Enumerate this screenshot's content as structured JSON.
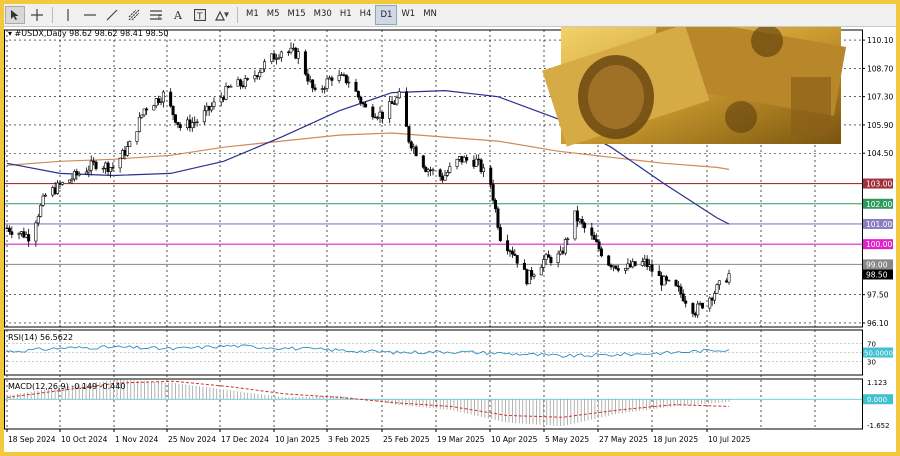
{
  "toolbar": {
    "timeframes": [
      "M1",
      "M5",
      "M15",
      "M30",
      "H1",
      "H4",
      "D1",
      "W1",
      "MN"
    ],
    "active_timeframe": "D1",
    "tools": [
      "cursor-icon",
      "crosshair-icon",
      "vertical-line-icon",
      "horizontal-line-icon",
      "trendline-icon",
      "channel-icon",
      "fibonacci-icon",
      "text-icon",
      "label-icon",
      "shapes-icon"
    ]
  },
  "header": {
    "symbol_label": "#USDX,Daily",
    "ohlc": "98.62 98.62 98.41 98.50"
  },
  "colors": {
    "candle": "#000000",
    "ma_fast": "#2b2f8f",
    "ma_slow": "#d08a55",
    "level_103": "#a0323c",
    "level_102": "#2e9a5e",
    "level_101": "#8a7ec0",
    "level_100": "#e020c8",
    "level_99": "#888888",
    "rsi": "#2f8fc0",
    "macd_signal": "#d03030",
    "macd_hist": "#a0a0a0",
    "macd_zero": "#40c0d0"
  },
  "chart_data": [
    {
      "type": "candlestick",
      "title": "#USDX,Daily",
      "ylim": [
        95.9,
        110.6
      ],
      "y_ticks": [
        110.1,
        108.7,
        107.3,
        105.9,
        104.5,
        97.5,
        96.1
      ],
      "x_ticks": [
        "18 Sep 2024",
        "10 Oct 2024",
        "1 Nov 2024",
        "25 Nov 2024",
        "17 Dec 2024",
        "10 Jan 2025",
        "3 Feb 2025",
        "25 Feb 2025",
        "19 Mar 2025",
        "10 Apr 2025",
        "5 May 2025",
        "27 May 2025",
        "18 Jun 2025",
        "10 Jul 2025"
      ],
      "close_path": [
        [
          "2024-09-18",
          100.8
        ],
        [
          "2024-09-27",
          100.4
        ],
        [
          "2024-10-04",
          102.4
        ],
        [
          "2024-10-10",
          102.9
        ],
        [
          "2024-10-18",
          103.5
        ],
        [
          "2024-10-25",
          104.0
        ],
        [
          "2024-11-01",
          103.8
        ],
        [
          "2024-11-08",
          104.9
        ],
        [
          "2024-11-14",
          106.7
        ],
        [
          "2024-11-22",
          107.4
        ],
        [
          "2024-11-29",
          105.8
        ],
        [
          "2024-12-06",
          106.1
        ],
        [
          "2024-12-13",
          106.9
        ],
        [
          "2024-12-20",
          107.8
        ],
        [
          "2024-12-27",
          108.0
        ],
        [
          "2025-01-03",
          108.9
        ],
        [
          "2025-01-10",
          109.6
        ],
        [
          "2025-01-17",
          109.4
        ],
        [
          "2025-01-24",
          107.4
        ],
        [
          "2025-01-31",
          108.3
        ],
        [
          "2025-02-07",
          108.1
        ],
        [
          "2025-02-14",
          106.7
        ],
        [
          "2025-02-21",
          106.4
        ],
        [
          "2025-02-28",
          107.3
        ],
        [
          "2025-03-04",
          105.2
        ],
        [
          "2025-03-11",
          103.8
        ],
        [
          "2025-03-18",
          103.3
        ],
        [
          "2025-03-25",
          104.2
        ],
        [
          "2025-04-01",
          104.1
        ],
        [
          "2025-04-07",
          103.0
        ],
        [
          "2025-04-11",
          100.4
        ],
        [
          "2025-04-17",
          99.5
        ],
        [
          "2025-04-22",
          98.3
        ],
        [
          "2025-04-29",
          99.2
        ],
        [
          "2025-05-06",
          99.4
        ],
        [
          "2025-05-12",
          101.4
        ],
        [
          "2025-05-19",
          100.3
        ],
        [
          "2025-05-26",
          99.1
        ],
        [
          "2025-06-02",
          98.8
        ],
        [
          "2025-06-10",
          99.1
        ],
        [
          "2025-06-17",
          98.2
        ],
        [
          "2025-06-24",
          97.7
        ],
        [
          "2025-07-01",
          96.7
        ],
        [
          "2025-07-08",
          97.5
        ],
        [
          "2025-07-15",
          98.5
        ]
      ],
      "ma_fast": [
        [
          "2024-09-18",
          104.0
        ],
        [
          "2024-10-10",
          103.5
        ],
        [
          "2024-11-01",
          103.4
        ],
        [
          "2024-11-25",
          103.5
        ],
        [
          "2024-12-17",
          104.1
        ],
        [
          "2025-01-10",
          105.3
        ],
        [
          "2025-02-03",
          106.6
        ],
        [
          "2025-02-25",
          107.5
        ],
        [
          "2025-03-19",
          107.6
        ],
        [
          "2025-04-10",
          107.3
        ],
        [
          "2025-05-05",
          106.2
        ],
        [
          "2025-05-27",
          104.8
        ],
        [
          "2025-06-18",
          103.0
        ],
        [
          "2025-07-10",
          101.3
        ],
        [
          "2025-07-15",
          101.0
        ]
      ],
      "ma_slow": [
        [
          "2024-09-18",
          103.9
        ],
        [
          "2024-10-10",
          104.1
        ],
        [
          "2024-11-01",
          104.2
        ],
        [
          "2024-11-25",
          104.4
        ],
        [
          "2024-12-17",
          104.8
        ],
        [
          "2025-01-10",
          105.1
        ],
        [
          "2025-02-03",
          105.4
        ],
        [
          "2025-02-25",
          105.5
        ],
        [
          "2025-03-19",
          105.3
        ],
        [
          "2025-04-10",
          105.1
        ],
        [
          "2025-05-05",
          104.6
        ],
        [
          "2025-05-27",
          104.3
        ],
        [
          "2025-06-18",
          104.0
        ],
        [
          "2025-07-10",
          103.8
        ],
        [
          "2025-07-15",
          103.7
        ]
      ],
      "horizontal_levels": [
        {
          "label": "103.00",
          "value": 103.0
        },
        {
          "label": "102.00",
          "value": 102.0
        },
        {
          "label": "101.00",
          "value": 101.0
        },
        {
          "label": "100.00",
          "value": 100.0
        },
        {
          "label": "99.00",
          "value": 99.0
        }
      ],
      "current_price": "98.50"
    },
    {
      "type": "line",
      "title": "RSI(14) 56.5622",
      "ylim": [
        0,
        100
      ],
      "y_ticks": [
        70,
        50,
        30
      ],
      "level_labels": {
        "70": "70",
        "50": "50.0000",
        "30": "30"
      },
      "values": [
        52,
        60,
        62,
        58,
        65,
        60,
        55,
        50,
        52,
        48,
        42,
        45,
        50,
        57
      ]
    },
    {
      "type": "line",
      "title": "MACD(12,26,9) -0.149 -0.440",
      "ylim": [
        -1.652,
        1.123
      ],
      "y_ticks": [
        "1.123",
        "0.000",
        "-1.652"
      ],
      "signal": [
        0.1,
        0.5,
        0.9,
        1.0,
        0.7,
        0.3,
        0.1,
        -0.2,
        -0.4,
        -0.9,
        -1.0,
        -0.6,
        -0.3,
        -0.4
      ],
      "histogram": [
        0.2,
        0.7,
        1.1,
        0.9,
        0.5,
        0.1,
        0.2,
        -0.3,
        -0.6,
        -1.3,
        -1.5,
        -0.8,
        -0.4,
        -0.15
      ]
    }
  ]
}
